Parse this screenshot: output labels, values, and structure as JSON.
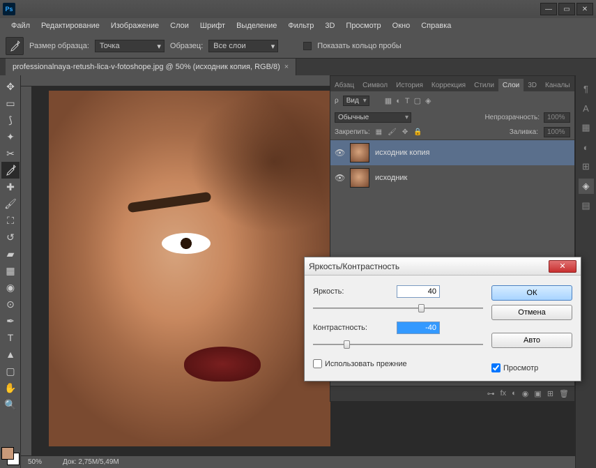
{
  "titlebar": {
    "logo": "Ps"
  },
  "menu": [
    "Файл",
    "Редактирование",
    "Изображение",
    "Слои",
    "Шрифт",
    "Выделение",
    "Фильтр",
    "3D",
    "Просмотр",
    "Окно",
    "Справка"
  ],
  "options": {
    "sample_size_label": "Размер образца:",
    "sample_size_value": "Точка",
    "sample_label": "Образец:",
    "sample_value": "Все слои",
    "show_ring": "Показать кольцо пробы"
  },
  "doc_tab": {
    "title": "professionalnaya-retush-lica-v-fotoshope.jpg @ 50% (исходник копия, RGB/8)"
  },
  "status": {
    "zoom": "50%",
    "doc": "Док: 2,75M/5,49M"
  },
  "panel_tabs": [
    "Абзац",
    "Символ",
    "История",
    "Коррекция",
    "Стили",
    "Слои",
    "3D",
    "Каналы"
  ],
  "layers_panel": {
    "filter_label": "Вид",
    "blend_mode": "Обычные",
    "opacity_label": "Непрозрачность:",
    "opacity_value": "100%",
    "lock_label": "Закрепить:",
    "fill_label": "Заливка:",
    "fill_value": "100%",
    "layers": [
      {
        "name": "исходник копия",
        "selected": true
      },
      {
        "name": "исходник",
        "selected": false
      }
    ]
  },
  "dialog": {
    "title": "Яркость/Контрастность",
    "brightness_label": "Яркость:",
    "brightness_value": "40",
    "contrast_label": "Контрастность:",
    "contrast_value": "-40",
    "use_legacy": "Использовать прежние",
    "preview": "Просмотр",
    "ok": "ОК",
    "cancel": "Отмена",
    "auto": "Авто"
  }
}
